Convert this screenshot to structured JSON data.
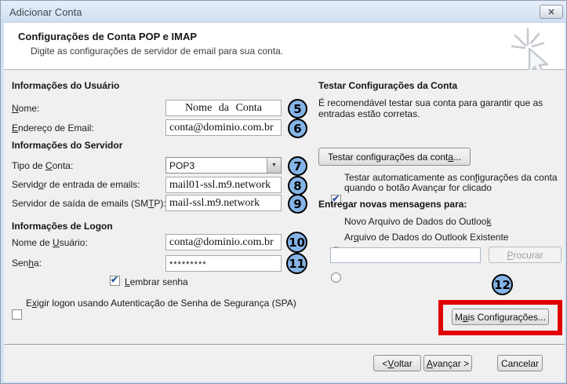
{
  "window": {
    "title": "Adicionar Conta"
  },
  "header": {
    "title": "Configurações de Conta POP e IMAP",
    "subtitle": "Digite as configurações de servidor de email para sua conta."
  },
  "user_info": {
    "heading": "Informações do Usuário",
    "name_label": "Nome:",
    "name_value": "Nome da Conta",
    "email_label": "Endereço de Email:",
    "email_value": "conta@dominio.com.br"
  },
  "server_info": {
    "heading": "Informações do Servidor",
    "account_type_label": "Tipo de Conta:",
    "account_type_value": "POP3",
    "incoming_label": "Servidor de entrada de emails:",
    "incoming_value": "mail01-ssl.m9.network",
    "outgoing_label": "Servidor de saída de emails (SMTP):",
    "outgoing_value": "mail-ssl.m9.network"
  },
  "logon_info": {
    "heading": "Informações de Logon",
    "username_label": "Nome de Usuário:",
    "username_value": "conta@dominio.com.br",
    "password_label": "Senha:",
    "password_value": "*********",
    "remember_password_label": "Lembrar senha",
    "spa_label": "Exigir logon usando Autenticação de Senha de Segurança (SPA)"
  },
  "test_section": {
    "heading": "Testar Configurações da Conta",
    "description": "É recomendável testar sua conta para garantir que as entradas estão corretas.",
    "test_button_label": "Testar configurações da conta...",
    "auto_test_label": "Testar automaticamente as configurações da conta quando o botão Avançar for clicado",
    "deliver_heading": "Entregar novas mensagens para:",
    "radio_new_label": "Novo Arquivo de Dados do Outlook",
    "radio_existing_label": "Arquivo de Dados do Outlook Existente",
    "path_value": "",
    "browse_button_label": "Procurar",
    "more_settings_button_label": "Mais Configurações..."
  },
  "footer": {
    "back_label": "< Voltar",
    "next_label": "Avançar >",
    "cancel_label": "Cancelar"
  },
  "annotations": {
    "badges": [
      "5",
      "6",
      "7",
      "8",
      "9",
      "10",
      "11",
      "12"
    ],
    "badge_fill_color": "#85b4e7",
    "highlight_color": "#e00000"
  },
  "icons": {
    "close": "✕",
    "dropdown_arrow": "▼"
  }
}
